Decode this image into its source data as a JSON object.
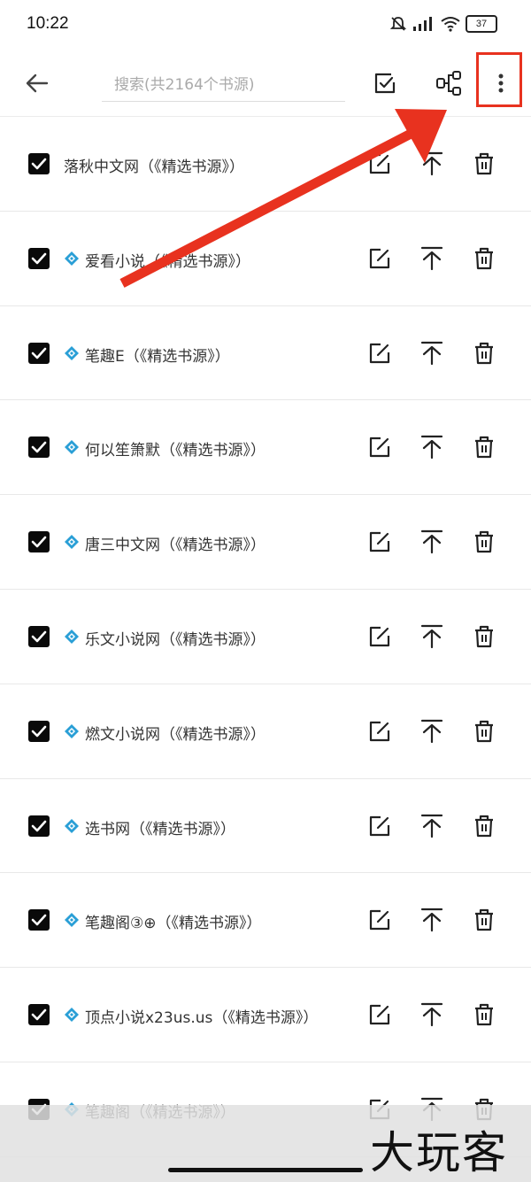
{
  "status_bar": {
    "time": "10:22",
    "battery": "37"
  },
  "top_bar": {
    "search_placeholder": "搜索(共2164个书源)"
  },
  "accent_colors": {
    "diamond": "#2a9fd6",
    "annotation": "#e8321f",
    "checkbox": "#0a0a0a"
  },
  "sources": [
    {
      "name": "落秋中文网（《精选书源》）",
      "diamond": false,
      "checked": true
    },
    {
      "name": "爱看小说（《精选书源》）",
      "diamond": true,
      "checked": true
    },
    {
      "name": "笔趣E（《精选书源》）",
      "diamond": true,
      "checked": true
    },
    {
      "name": "何以笙箫默（《精选书源》）",
      "diamond": true,
      "checked": true
    },
    {
      "name": "唐三中文网（《精选书源》）",
      "diamond": true,
      "checked": true
    },
    {
      "name": "乐文小说网（《精选书源》）",
      "diamond": true,
      "checked": true
    },
    {
      "name": "燃文小说网（《精选书源》）",
      "diamond": true,
      "checked": true
    },
    {
      "name": "选书网（《精选书源》）",
      "diamond": true,
      "checked": true
    },
    {
      "name": "笔趣阁③⊕（《精选书源》）",
      "diamond": true,
      "checked": true
    },
    {
      "name": "顶点小说x23us.us（《精选书源》）",
      "diamond": true,
      "checked": true
    },
    {
      "name": "笔趣阁（《精选书源》）",
      "diamond": true,
      "checked": true
    }
  ],
  "watermark": "大玩客"
}
